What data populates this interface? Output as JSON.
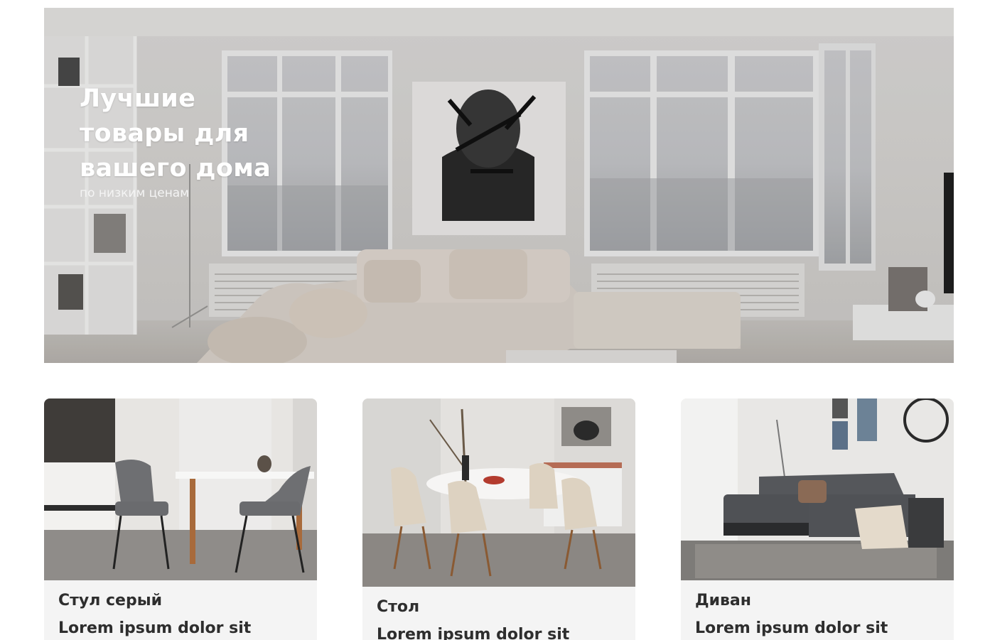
{
  "hero": {
    "title": "Лучшие товары для вашего дома",
    "subtitle": "по низким ценам",
    "image_icon": "living-room-photo"
  },
  "products": [
    {
      "name": "Стул серый",
      "description": "Lorem ipsum dolor sit",
      "image_icon": "grey-chairs-photo"
    },
    {
      "name": "Стол",
      "description": "Lorem ipsum dolor sit",
      "image_icon": "dining-table-photo"
    },
    {
      "name": "Диван",
      "description": "Lorem ipsum dolor sit",
      "image_icon": "corner-sofa-photo"
    }
  ],
  "colors": {
    "card_background": "#f4f4f4",
    "text": "#2e2e2e",
    "hero_text": "#ffffff"
  }
}
